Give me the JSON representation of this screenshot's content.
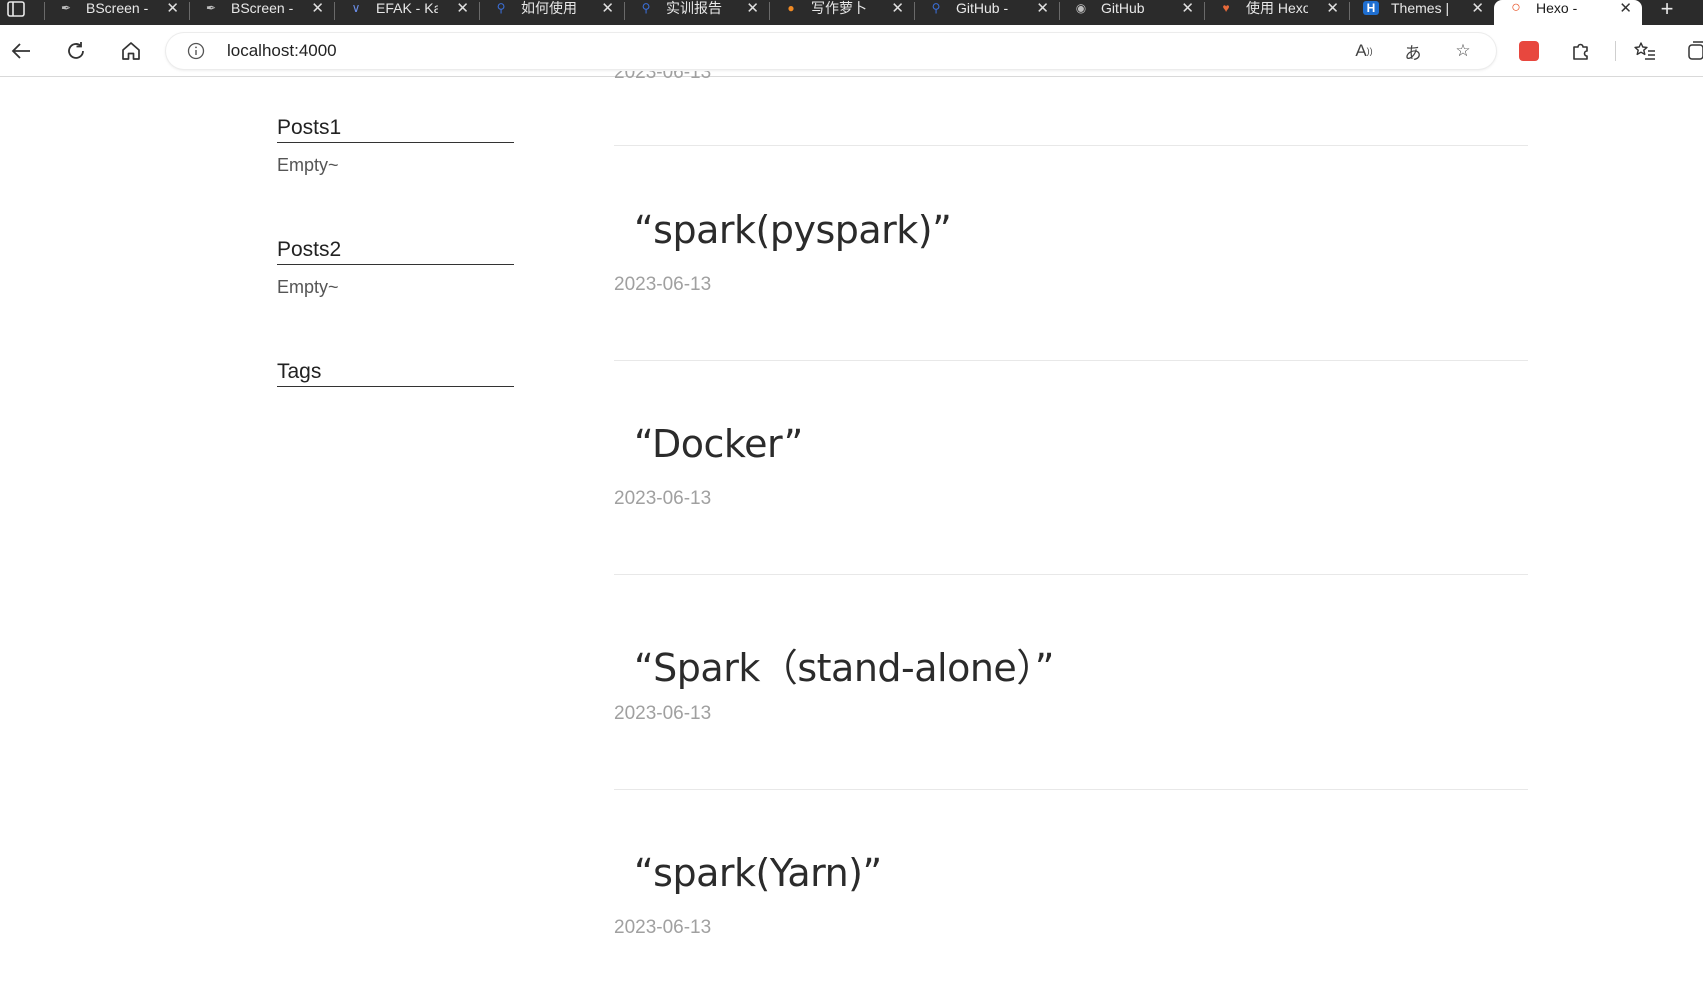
{
  "browser": {
    "tabs": [
      {
        "title": "BScreen -",
        "icon": "feather-icon"
      },
      {
        "title": "BScreen -",
        "icon": "feather-icon"
      },
      {
        "title": "EFAK - Ka",
        "icon": "efak-icon"
      },
      {
        "title": "如何使用",
        "icon": "search-icon"
      },
      {
        "title": "实训报告",
        "icon": "search-icon"
      },
      {
        "title": "写作萝卜",
        "icon": "carrot-icon"
      },
      {
        "title": "GitHub -",
        "icon": "search-icon"
      },
      {
        "title": "GitHub",
        "icon": "github-icon"
      },
      {
        "title": "使用 Hexo",
        "icon": "heart-icon"
      },
      {
        "title": "Themes |",
        "icon": "hexo-h-icon"
      },
      {
        "title": "Hexo -",
        "icon": "hexo-ring-icon",
        "active": true
      }
    ],
    "address": "localhost:4000",
    "accent": "#e8562a"
  },
  "sidebar": {
    "posts1_title": "Posts1",
    "posts1_body": "Empty~",
    "posts2_title": "Posts2",
    "posts2_body": "Empty~",
    "tags_title": "Tags"
  },
  "posts": {
    "top_date": "2023-06-13",
    "items": [
      {
        "title": "“spark(pyspark)”",
        "date": "2023-06-13"
      },
      {
        "title": "“Docker”",
        "date": "2023-06-13"
      },
      {
        "title": "“Spark（stand-alone）”",
        "date": "2023-06-13"
      },
      {
        "title": "“spark(Yarn)”",
        "date": "2023-06-13"
      }
    ]
  }
}
